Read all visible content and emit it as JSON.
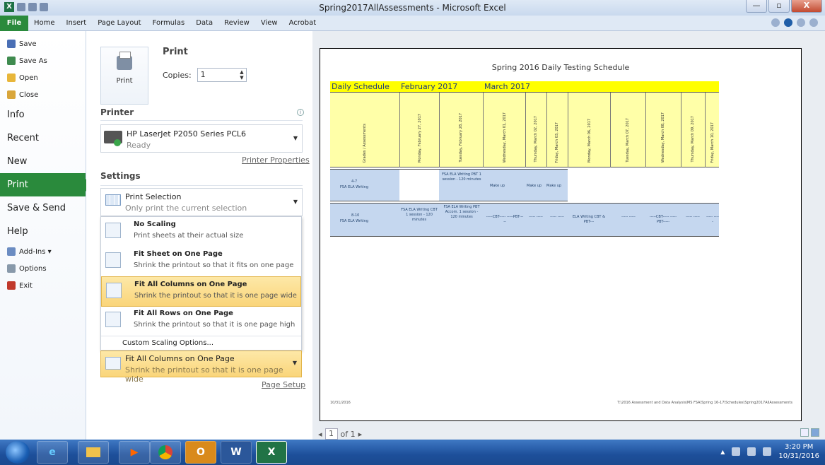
{
  "window": {
    "title": "Spring2017AllAssessments - Microsoft Excel",
    "minimize": "—",
    "maximize": "▫",
    "close": "X"
  },
  "ribbon_tabs": [
    "File",
    "Home",
    "Insert",
    "Page Layout",
    "Formulas",
    "Data",
    "Review",
    "View",
    "Acrobat"
  ],
  "backstage": {
    "top_items": [
      "Save",
      "Save As",
      "Open",
      "Close"
    ],
    "big_items": [
      "Info",
      "Recent",
      "New",
      "Print",
      "Save & Send",
      "Help"
    ],
    "bottom_items": [
      "Add-Ins ▾",
      "Options",
      "Exit"
    ],
    "active": "Print"
  },
  "print": {
    "heading": "Print",
    "button_label": "Print",
    "copies_label": "Copies:",
    "copies_value": "1",
    "printer_heading": "Printer",
    "printer_name": "HP LaserJet P2050 Series PCL6",
    "printer_status": "Ready",
    "printer_properties": "Printer Properties",
    "settings_heading": "Settings",
    "selection_title": "Print Selection",
    "selection_sub": "Only print the current selection",
    "scaling_options": [
      {
        "title": "No Scaling",
        "sub": "Print sheets at their actual size"
      },
      {
        "title": "Fit Sheet on One Page",
        "sub": "Shrink the printout so that it fits on one page"
      },
      {
        "title": "Fit All Columns on One Page",
        "sub": "Shrink the printout so that it is one page wide"
      },
      {
        "title": "Fit All Rows on One Page",
        "sub": "Shrink the printout so that it is one page high"
      }
    ],
    "custom_scaling": "Custom Scaling Options...",
    "current_scaling_title": "Fit All Columns on One Page",
    "current_scaling_sub": "Shrink the printout so that it is one page wide",
    "page_setup": "Page Setup"
  },
  "preview": {
    "sheet_title": "Spring 2016 Daily Testing Schedule",
    "header_cells": [
      "Daily Schedule",
      "February 2017",
      "March 2017"
    ],
    "dates": [
      "Grades / Assessments",
      "Monday, February 27, 2017",
      "Tuesday, February 28, 2017",
      "Wednesday, March 01, 2017",
      "Thursday, March 02, 2017",
      "Friday, March 03, 2017",
      "Monday, March 06, 2017",
      "Tuesday, March 07, 2017",
      "Wednesday, March 08, 2017",
      "Thursday, March 09, 2017",
      "Friday, March 10, 2017"
    ],
    "row1": {
      "grade": "4-7",
      "assessment": "FSA ELA Writing",
      "tue": "FSA ELA Writing PBT 1 session - 120 minutes",
      "wed": "Make up",
      "thu": "Make up",
      "fri": "Make up"
    },
    "row2": {
      "grade": "8-10",
      "assessment": "FSA ELA Writing",
      "mon": "FSA ELA Writing CBT 1 session - 120 minutes",
      "tue": "FSA ELA Writing PBT Accom. 1 session - 120 minutes",
      "wed": "-----CBT----- -----PBT-----",
      "thu": "----- -----",
      "fri": "----- -----",
      "mon2": "ELA Writing CBT & PBT---",
      "tue2": "----- -----",
      "wed2": "-----CBT----- -----PBT-----",
      "thu2": "----- -----",
      "fri2": "----- -----"
    },
    "footer_left": "10/31/2016",
    "footer_right": "T:\\2016 Assessment and Data Analysis\\MS FSA\\Spring 16-17\\Schedules\\Spring2017AllAssessments",
    "page_current": "1",
    "page_total": "of 1"
  },
  "taskbar": {
    "clock_time": "3:20 PM",
    "clock_date": "10/31/2016",
    "apps": [
      "IE",
      "Explorer",
      "Media",
      "Chrome",
      "Outlook",
      "Word",
      "Excel"
    ]
  },
  "colors": {
    "file_green": "#2a8a3c",
    "highlight": "#fad57a",
    "yellow": "#ffff00",
    "blue_row": "#c5d7ef"
  }
}
